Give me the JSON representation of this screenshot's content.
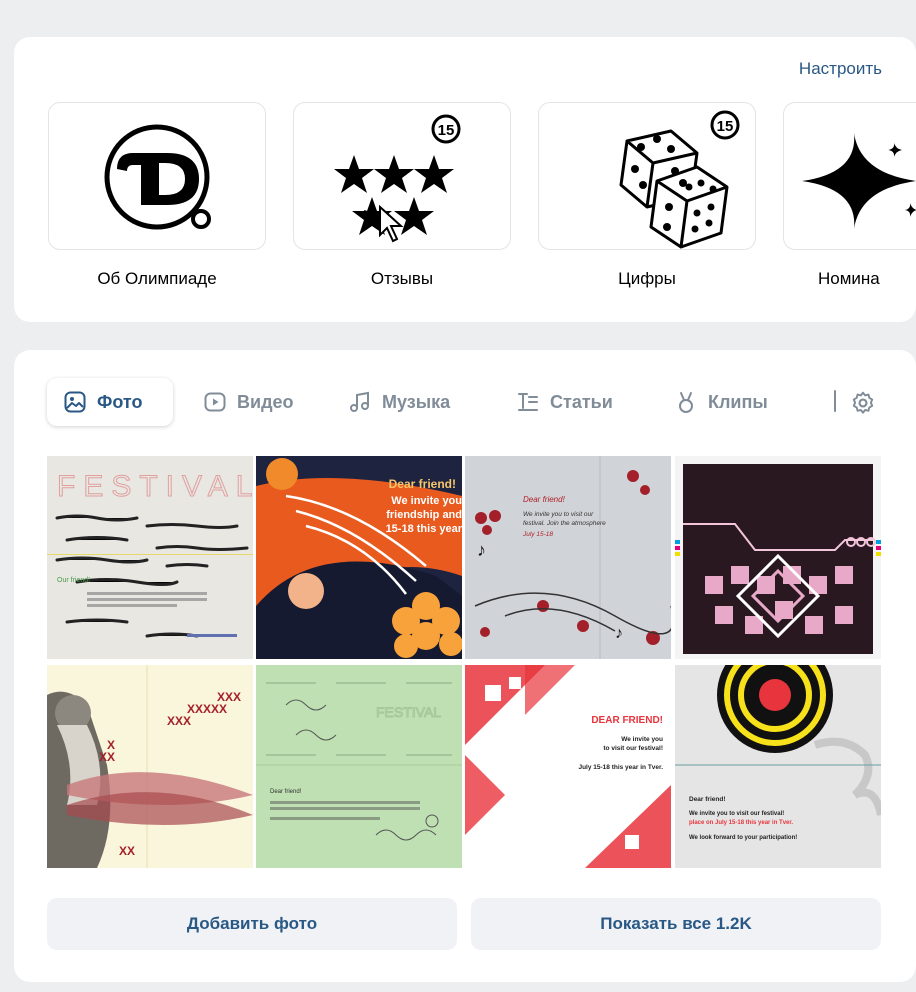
{
  "sections": {
    "settings_label": "Настроить",
    "items": [
      {
        "label": "Об Олимпиаде",
        "icon": "olympiad-logo-icon"
      },
      {
        "label": "Отзывы",
        "icon": "stars-icon"
      },
      {
        "label": "Цифры",
        "icon": "dice-icon"
      },
      {
        "label": "Номина",
        "icon": "sparkle-icon"
      }
    ]
  },
  "media": {
    "tabs": [
      {
        "label": "Фото",
        "icon": "photo-icon",
        "active": true
      },
      {
        "label": "Видео",
        "icon": "video-icon",
        "active": false
      },
      {
        "label": "Музыка",
        "icon": "music-icon",
        "active": false
      },
      {
        "label": "Статьи",
        "icon": "articles-icon",
        "active": false
      },
      {
        "label": "Клипы",
        "icon": "clips-icon",
        "active": false
      }
    ],
    "photos": [
      {
        "heading": "FESTIVAL",
        "line1": "Our friend!"
      },
      {
        "heading": "Dear friend!",
        "line1": "We invite you",
        "line2": "friendship and",
        "line3": "15-18 this year"
      },
      {
        "heading": "Dear friend!",
        "line1": "We invite you to visit our",
        "line2": "festival. Join the atmosphere",
        "line3": "July 15-18"
      },
      {
        "heading": ""
      },
      {
        "heading": ""
      },
      {
        "heading": "Dear friend!"
      },
      {
        "heading": "DEAR FRIEND!",
        "line1": "We invite you",
        "line2": "to visit our festival!",
        "line3": "July 15-18 this year in Tver."
      },
      {
        "heading": "Dear friend!",
        "line1": "We invite you to visit our festival!",
        "line2": "place on July 15-18 this year in Tver.",
        "line3": "We look forward to your participation!"
      }
    ],
    "add_photo_label": "Добавить фото",
    "show_all_label": "Показать все 1.2K"
  },
  "colors": {
    "link": "#2a5885",
    "tab_inactive": "#818c99",
    "background": "#edeef0",
    "button_bg": "#f0f2f5"
  }
}
